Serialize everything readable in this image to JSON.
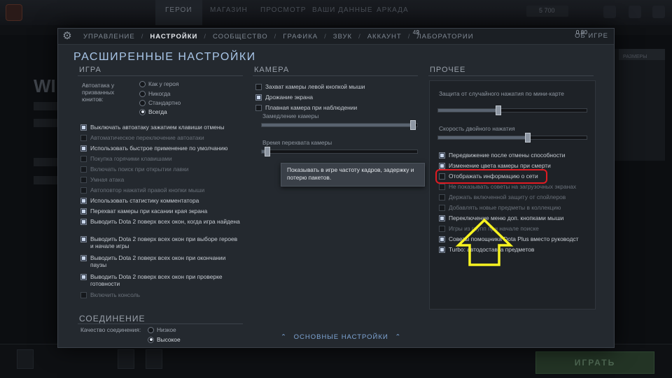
{
  "background": {
    "nav": [
      "ГЕРОИ",
      "МАГАЗИН",
      "ПРОСМОТР",
      "ВАШИ ДАННЫЕ",
      "АРКАДА"
    ],
    "currency": "5 700",
    "play_label": "ИГРАТЬ",
    "hero_title": "WI",
    "right_button": "РАЗМЕРЫ"
  },
  "tabs": {
    "items": [
      "УПРАВЛЕНИЕ",
      "НАСТРОЙКИ",
      "СООБЩЕСТВО",
      "ГРАФИКА",
      "ЗВУК",
      "АККАУНТ",
      "ЛАБОРАТОРИИ"
    ],
    "active_index": 1,
    "about": "ОБ ИГРЕ"
  },
  "title": "РАСШИРЕННЫЕ НАСТРОЙКИ",
  "game": {
    "section_title": "ИГРА",
    "autoattack_label": "Автоатака у призванных юнитов:",
    "autoattack_options": [
      {
        "label": "Как у героя",
        "selected": false
      },
      {
        "label": "Никогда",
        "selected": false
      },
      {
        "label": "Стандартно",
        "selected": false
      },
      {
        "label": "Всегда",
        "selected": true
      }
    ],
    "checkboxes": [
      {
        "label": "Выключать автоатаку зажатием клавиши отмены",
        "checked": true,
        "enabled": true
      },
      {
        "label": "Автоматическое переключение автоатаки",
        "checked": false,
        "enabled": false
      },
      {
        "label": "Использовать быстрое применение по умолчанию",
        "checked": true,
        "enabled": true
      },
      {
        "label": "Покупка горячими клавишами",
        "checked": false,
        "enabled": false
      },
      {
        "label": "Включать поиск при открытии лавки",
        "checked": false,
        "enabled": false
      },
      {
        "label": "Умная атака",
        "checked": false,
        "enabled": false
      },
      {
        "label": "Автоповтор нажатий правой кнопки мыши",
        "checked": false,
        "enabled": false
      },
      {
        "label": "Использовать статистику комментатора",
        "checked": true,
        "enabled": true
      },
      {
        "label": "Перехват камеры при касании края экрана",
        "checked": true,
        "enabled": true
      },
      {
        "label": "Выводить Dota 2 поверх всех окон, когда игра найдена",
        "checked": true,
        "enabled": true
      },
      {
        "label": "Выводить Dota 2 поверх всех окон при выборе героев и начале игры",
        "checked": true,
        "enabled": true
      },
      {
        "label": "Выводить Dota 2 поверх всех окон при окончании паузы",
        "checked": true,
        "enabled": true
      },
      {
        "label": "Выводить Dota 2 поверх всех окон при проверке готовности",
        "checked": true,
        "enabled": true
      },
      {
        "label": "Включить консоль",
        "checked": false,
        "enabled": false
      }
    ]
  },
  "connection": {
    "section_title": "СОЕДИНЕНИЕ",
    "quality_label": "Качество соединения:",
    "options": [
      {
        "label": "Низкое",
        "selected": false
      },
      {
        "label": "Высокое",
        "selected": true
      }
    ]
  },
  "camera": {
    "section_title": "КАМЕРА",
    "checkboxes": [
      {
        "label": "Захват камеры левой кнопкой мыши",
        "checked": false,
        "enabled": true
      },
      {
        "label": "Дрожание экрана",
        "checked": true,
        "enabled": true
      },
      {
        "label": "Плавная камера при наблюдении",
        "checked": false,
        "enabled": true
      }
    ],
    "sliders": [
      {
        "label": "Замедление камеры",
        "value": "49",
        "fraction": 0.98
      },
      {
        "label": "Время перехвата камеры",
        "value": "2",
        "fraction": 0.02
      }
    ]
  },
  "other": {
    "section_title": "ПРОЧЕЕ",
    "sliders": [
      {
        "label": "Защита от случайного нажатия по мини-карте",
        "value": "0.20",
        "fraction": 0.4
      },
      {
        "label": "Скорость двойного нажатия",
        "value": "0.60",
        "fraction": 0.6
      }
    ],
    "checkboxes": [
      {
        "label": "Передвижение после отмены способности",
        "checked": true,
        "enabled": true
      },
      {
        "label": "Изменение цвета камеры при смерти",
        "checked": true,
        "enabled": true
      },
      {
        "label": "Отображать информацию о сети",
        "checked": false,
        "enabled": true
      },
      {
        "label": "Не показывать советы на загрузочных экранах",
        "checked": false,
        "enabled": false
      },
      {
        "label": "Держать включенной защиту от спойлеров",
        "checked": false,
        "enabled": false
      },
      {
        "label": "Добавлять новые предметы в коллекцию",
        "checked": false,
        "enabled": false
      },
      {
        "label": "Переключение меню доп. кнопками мыши",
        "checked": true,
        "enabled": true
      },
      {
        "label": "Игры из групп при начале поиске",
        "checked": false,
        "enabled": false
      },
      {
        "label": "Советы помощника Dota Plus вместо руководст",
        "checked": true,
        "enabled": true
      },
      {
        "label": "Turbo: автодоставка предметов",
        "checked": true,
        "enabled": true
      }
    ]
  },
  "tooltip": "Показывать в игре частоту кадров, задержку и потерю пакетов.",
  "basic_settings_link": "ОСНОВНЫЕ НАСТРОЙКИ",
  "colors": {
    "highlight": "#e01b22",
    "arrow": "#f7f320",
    "title": "#a9c6e8"
  }
}
